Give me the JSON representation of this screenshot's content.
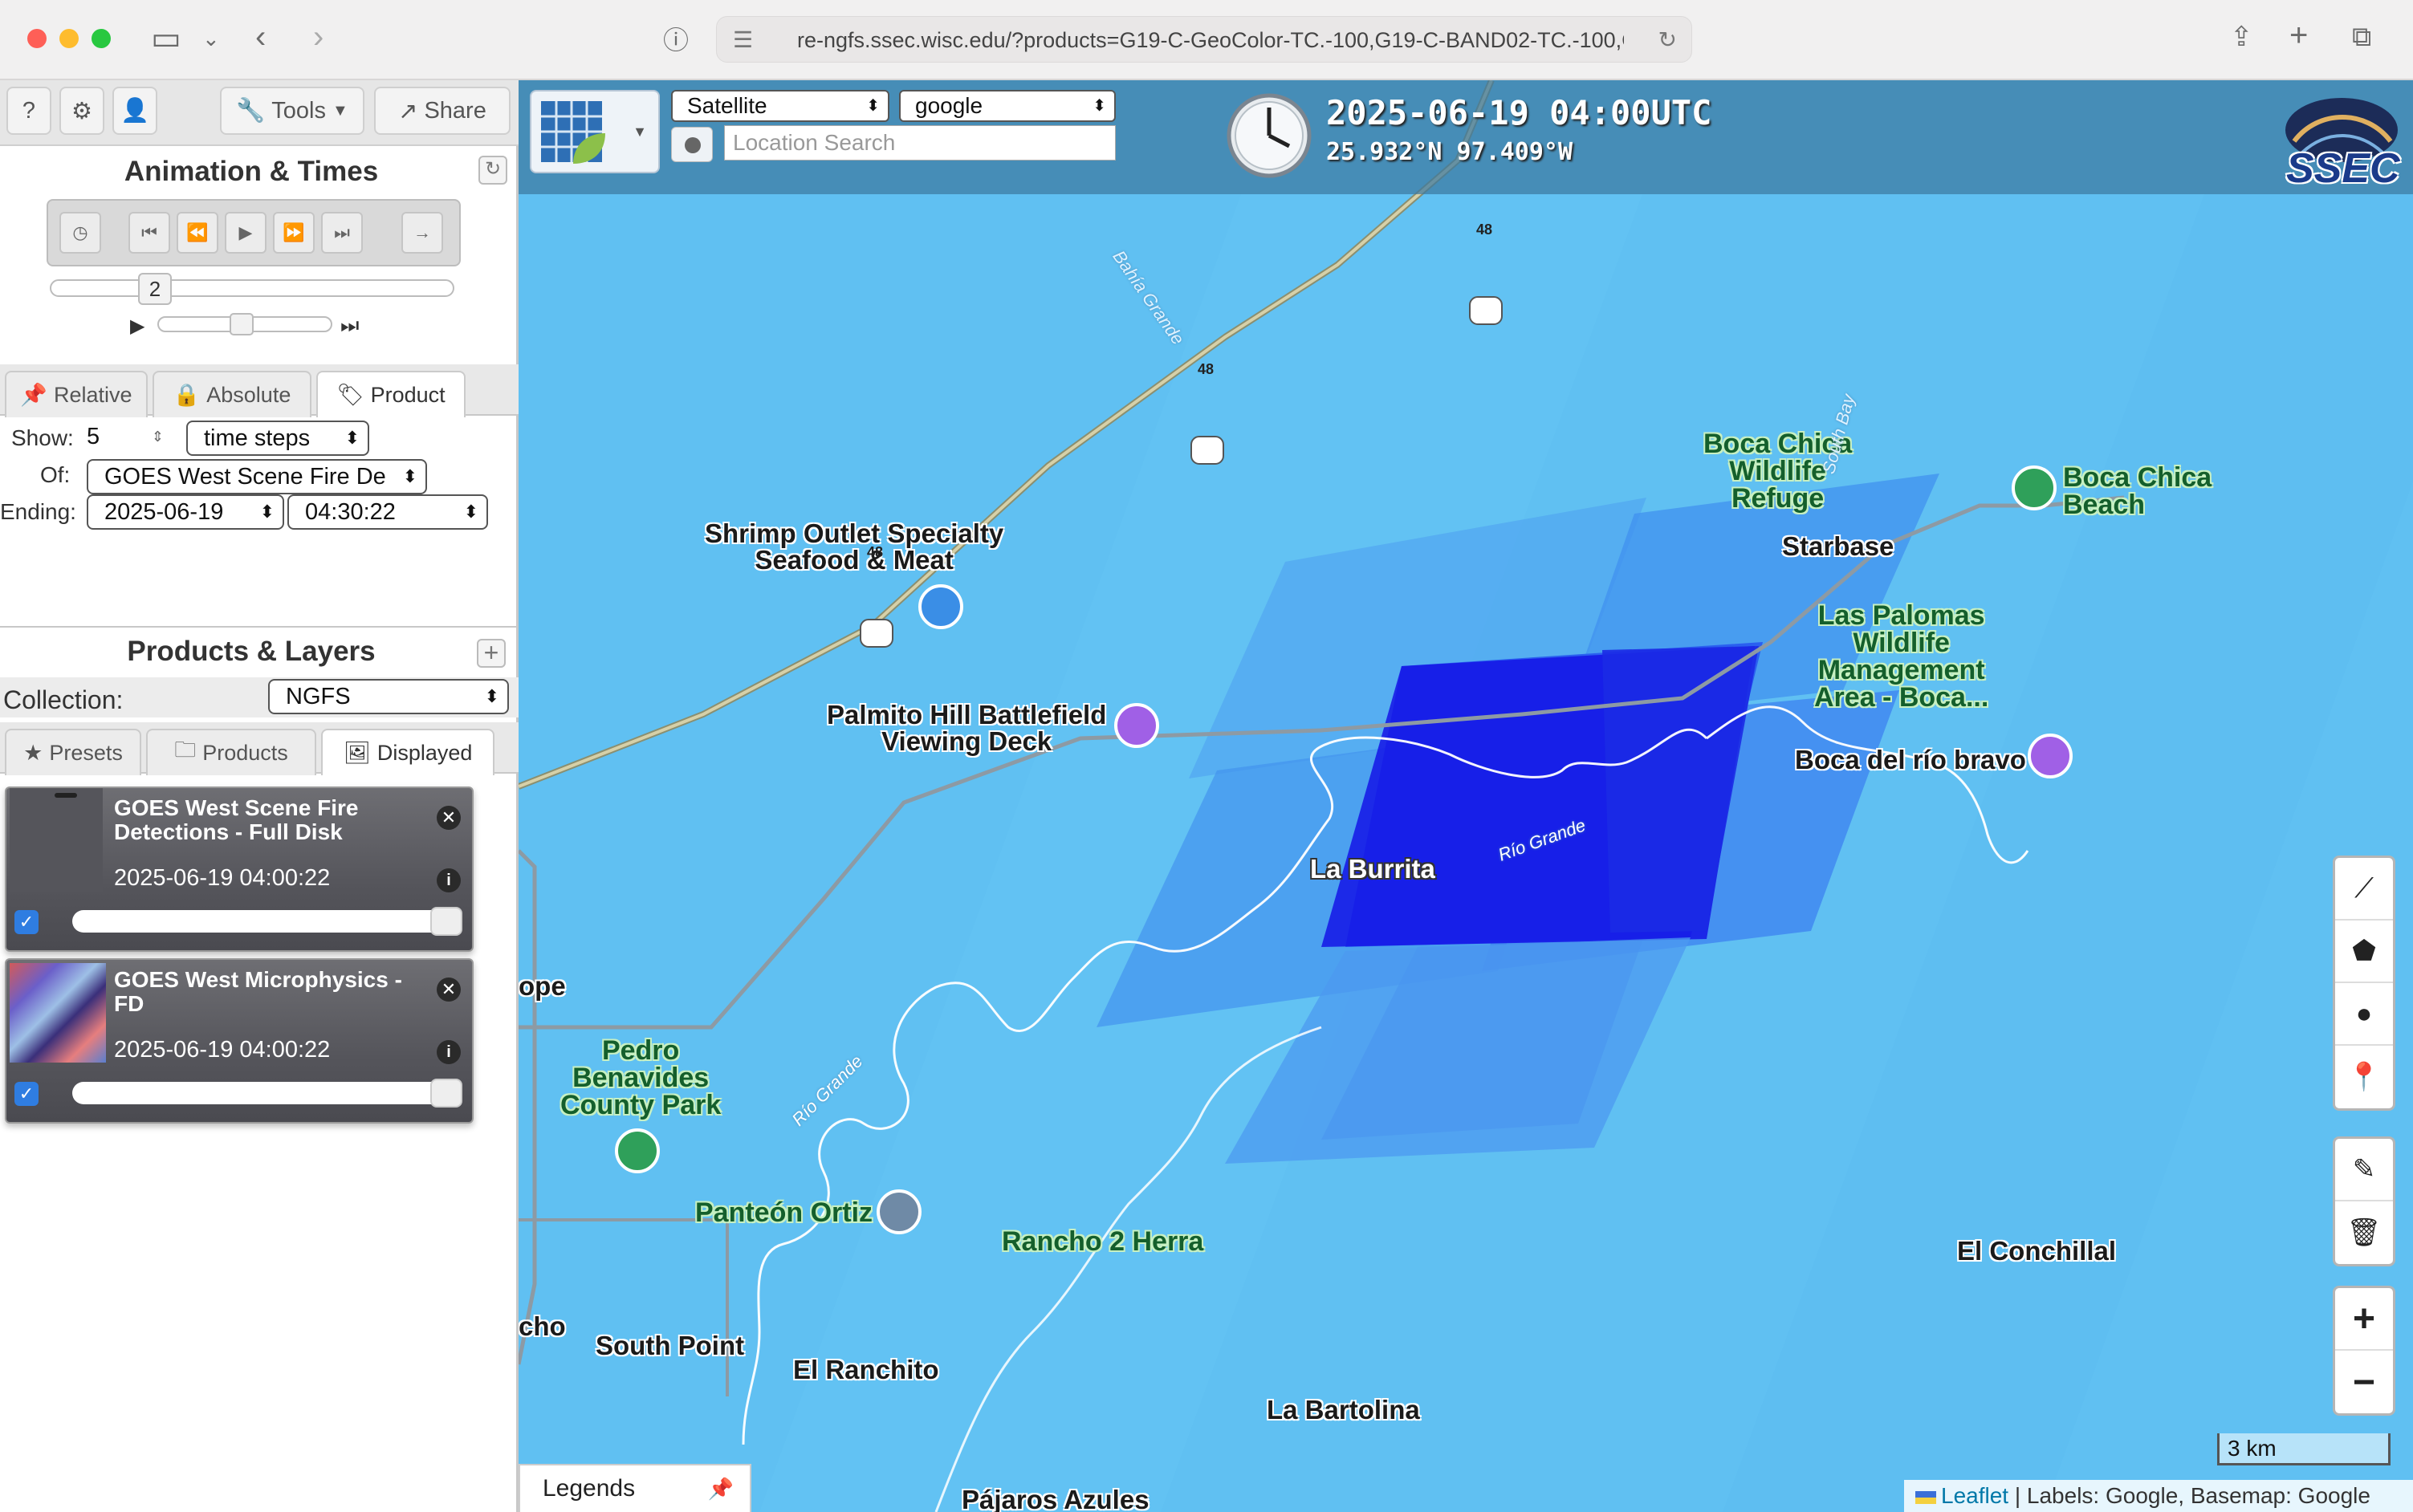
{
  "browser": {
    "url": "re-ngfs.ssec.wisc.edu/?products=G19-C-GeoColor-TC.-100,G19-C-BAND02-TC.-100,G"
  },
  "toolbar": {
    "help": "?",
    "tools": "Tools",
    "share": "Share"
  },
  "animation": {
    "title": "Animation & Times",
    "frame_value": "2",
    "tabs": [
      "Relative",
      "Absolute",
      "Product"
    ],
    "active_tab": "Product",
    "show_label": "Show:",
    "show_value": "5",
    "show_unit": "time steps",
    "of_label": "Of:",
    "of_value": "GOES West Scene Fire De",
    "ending_label": "Ending:",
    "ending_date": "2025-06-19",
    "ending_time": "04:30:22"
  },
  "products": {
    "title": "Products & Layers",
    "collection_label": "Collection:",
    "collection_value": "NGFS",
    "tabs": [
      "Presets",
      "Products",
      "Displayed"
    ],
    "active_tab": "Displayed",
    "layers": [
      {
        "title": "GOES West Scene Fire Detections - Full Disk",
        "time": "2025-06-19 04:00:22",
        "checked": true
      },
      {
        "title": "GOES West Microphysics - FD",
        "time": "2025-06-19 04:00:22",
        "checked": true
      }
    ]
  },
  "map": {
    "base_select": "Satellite",
    "label_select": "google",
    "search_placeholder": "Location Search",
    "datetime": "2025-06-19 04:00UTC",
    "latlon": "25.932°N 97.409°W",
    "logo": "SSEC",
    "scale": "3 km",
    "attribution_link": "Leaflet",
    "attribution_text": " | Labels: Google, Basemap: Google",
    "legends": "Legends",
    "places": {
      "shrimp": "Shrimp Outlet Specialty\nSeafood & Meat",
      "palmito": "Palmito Hill Battlefield\nViewing Deck",
      "boca_refuge": "Boca Chica\nWildlife\nRefuge",
      "boca_beach": "Boca Chica\nBeach",
      "starbase": "Starbase",
      "las_palomas": "Las Palomas\nWildlife\nManagement\nArea - Boca...",
      "boca_rio": "Boca del río bravo",
      "la_burrita": "La Burrita",
      "pedro": "Pedro\nBenavides\nCounty Park",
      "panteon": "Panteón Ortiz",
      "rancho": "Rancho 2 Herra",
      "el_conchillal": "El Conchillal",
      "south_point": "South Point",
      "el_ranchito": "El Ranchito",
      "la_bartolina": "La Bartolina",
      "pajaros": "Pájaros Azules",
      "ope": "ope",
      "cho": "cho",
      "rio1": "Río Grande",
      "rio2": "Río Grande",
      "bahia": "Bahía Grande",
      "south_bay": "South Bay",
      "hwy": "48"
    }
  }
}
